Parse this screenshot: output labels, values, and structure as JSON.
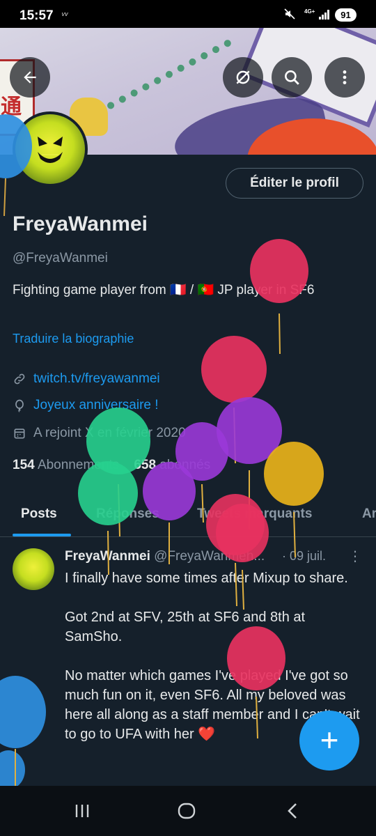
{
  "status": {
    "time": "15:57",
    "net_indicator": "ᵛᵛ",
    "network": "4G+",
    "battery": "91"
  },
  "header": {
    "back_icon": "arrow-left-icon",
    "grok_icon": "grok-icon",
    "search_icon": "search-icon",
    "more_icon": "more-vertical-icon"
  },
  "banner": {
    "sign_text": "通"
  },
  "profile": {
    "edit_label": "Éditer le profil",
    "display_name": "FreyaWanmei",
    "handle": "@FreyaWanmei",
    "bio": "Fighting game player from 🇫🇷 / 🇵🇹 JP player in SF6",
    "translate_label": "Traduire la biographie",
    "link": "twitch.tv/freyawanmei",
    "birthday": "Joyeux anniversaire !",
    "joined": "A rejoint X en février 2020",
    "following_count": "154",
    "following_label": "Abonnements",
    "followers_count": "658",
    "followers_label": "abonnés"
  },
  "tabs": [
    {
      "label": "Posts"
    },
    {
      "label": "Réponses"
    },
    {
      "label": "Tweets marquants"
    },
    {
      "label": "Ar"
    }
  ],
  "post": {
    "name": "FreyaWanmei",
    "handle": "@FreyaWanmeh...",
    "date": "· 09 juil.",
    "more": "⋮",
    "body": "I finally have some times after Mixup to share.\n\nGot 2nd at SFV, 25th at SF6 and 8th at SamSho.\n\nNo matter which games I've played I've got so much fun on it, even SF6. All my beloved was here all along as a staff member and I can't wait to go to UFA with her ❤️"
  },
  "fab": {
    "label": "+"
  },
  "colors": {
    "background": "#15202b",
    "accent": "#1d9bf0",
    "muted": "#8b98a5"
  }
}
